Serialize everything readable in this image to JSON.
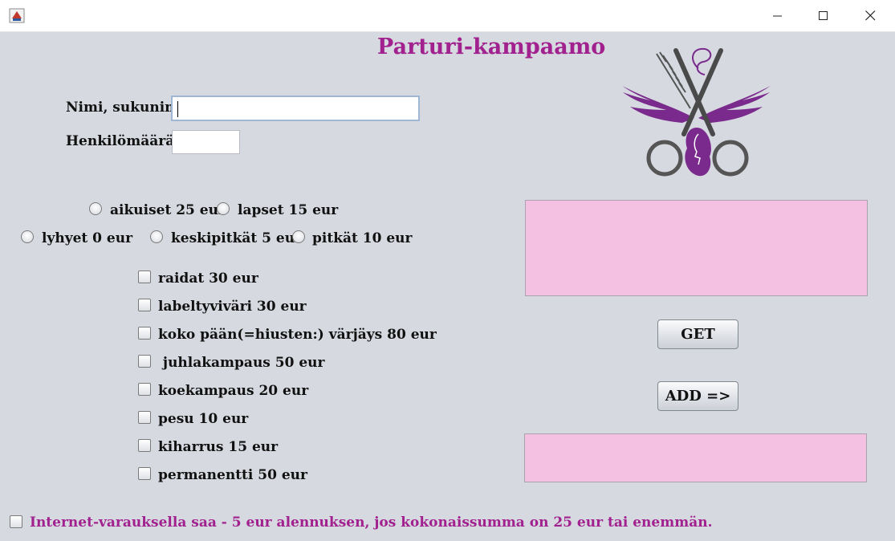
{
  "window": {
    "app_title": "Parturi-kampaamo"
  },
  "form": {
    "name_label": "Nimi, sukunimi",
    "name_value": "",
    "persons_label": "Henkilömäärä",
    "persons_value": ""
  },
  "age_options": [
    {
      "label": "aikuiset 25 eur",
      "selected": false
    },
    {
      "label": "lapset 15 eur",
      "selected": false
    }
  ],
  "hair_length_options": [
    {
      "label": "lyhyet 0 eur",
      "selected": false
    },
    {
      "label": "keskipitkät 5 eur",
      "selected": false
    },
    {
      "label": "pitkät 10 eur",
      "selected": false
    }
  ],
  "services": [
    {
      "label": "raidat 30 eur",
      "checked": false
    },
    {
      "label": "labeltyviväri 30 eur",
      "checked": false
    },
    {
      "label": "koko pään(=hiusten:)  värjäys 80 eur",
      "checked": false
    },
    {
      "label": " juhlakampaus 50 eur",
      "checked": false
    },
    {
      "label": "koekampaus 20 eur",
      "checked": false
    },
    {
      "label": "pesu 10 eur",
      "checked": false
    },
    {
      "label": "kiharrus 15 eur",
      "checked": false
    },
    {
      "label": "permanentti 50 eur",
      "checked": false
    }
  ],
  "buttons": {
    "get_label": "GET",
    "add_label": "ADD =>"
  },
  "output": {
    "top_text": "",
    "bottom_text": ""
  },
  "footer": {
    "discount_label": "Internet-varauksella saa - 5 eur alennuksen, jos kokonaissumma on 25 eur tai enemmän.",
    "discount_checked": false
  },
  "icons": {
    "app": "java-cup-icon",
    "logo": "scissors-wings-logo-icon"
  },
  "colors": {
    "accent": "#a1218e",
    "background": "#d6d9e0",
    "output_fill": "#f4c1e2",
    "logo_purple": "#7a2a8c"
  }
}
